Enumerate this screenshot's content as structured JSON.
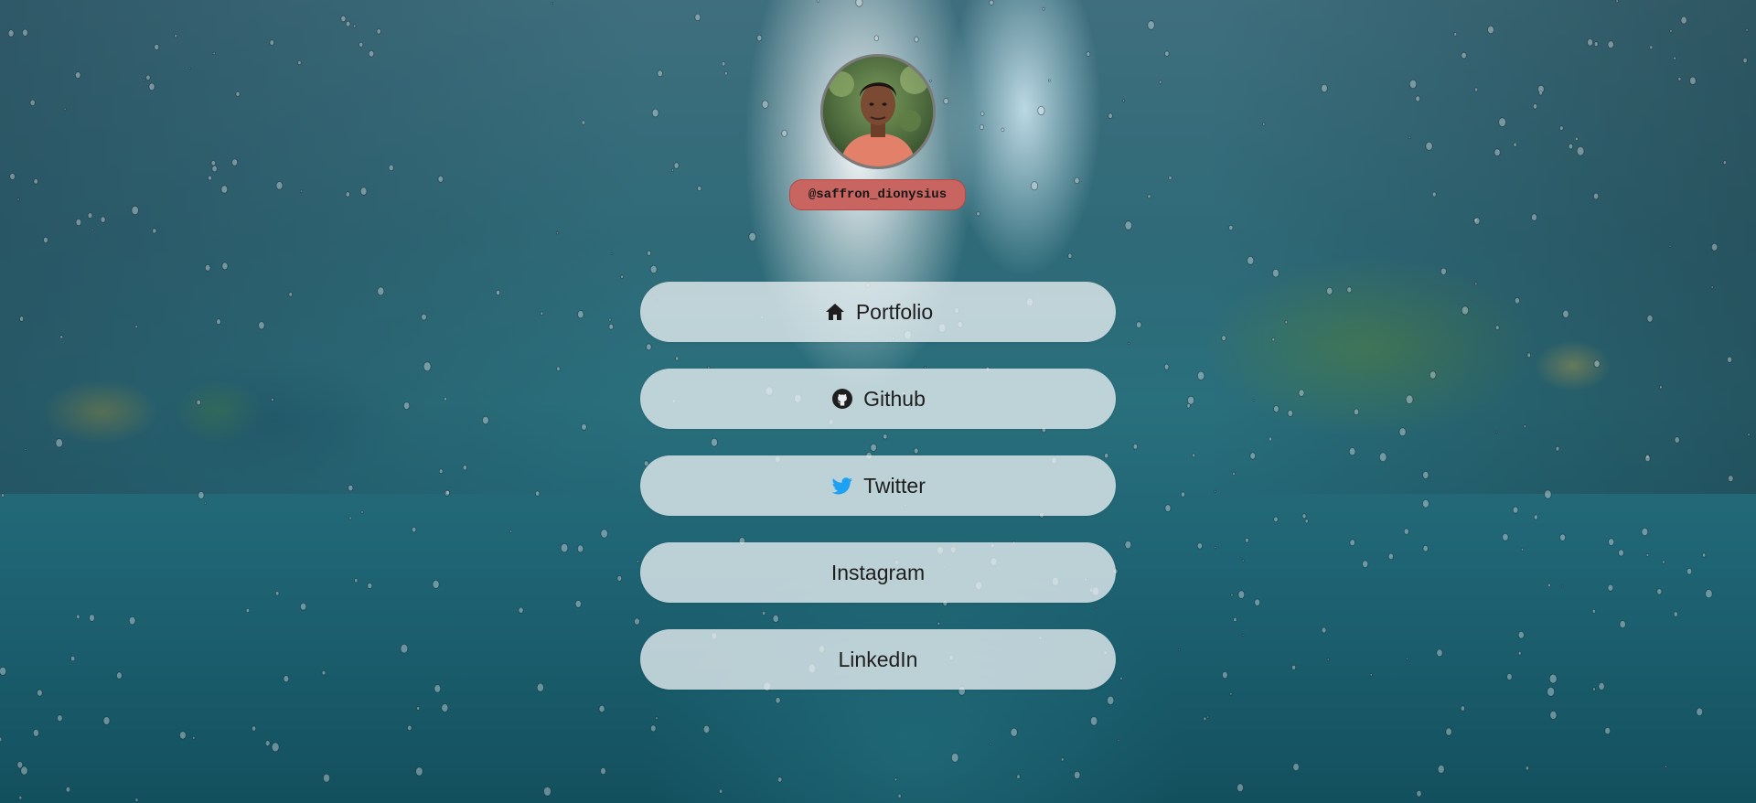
{
  "profile": {
    "handle": "@saffron_dionysius"
  },
  "links": [
    {
      "label": "Portfolio",
      "icon": "home-icon",
      "icon_color": "#1e1e1e"
    },
    {
      "label": "Github",
      "icon": "github-icon",
      "icon_color": "#1e1e1e"
    },
    {
      "label": "Twitter",
      "icon": "twitter-icon",
      "icon_color": "#1da1f2"
    },
    {
      "label": "Instagram",
      "icon": null
    },
    {
      "label": "LinkedIn",
      "icon": null
    }
  ],
  "colors": {
    "handle_bg": "#c96560",
    "button_bg": "rgba(232,240,242,0.78)",
    "background": "#2a6f7c"
  }
}
